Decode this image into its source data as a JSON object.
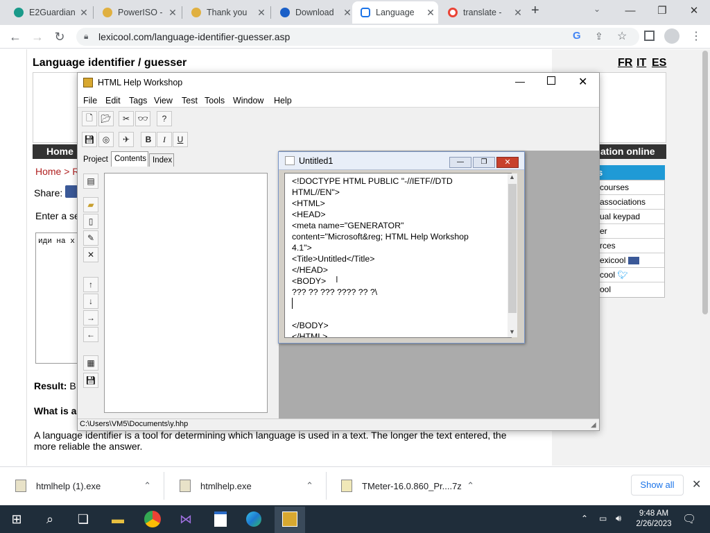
{
  "browser": {
    "tabs": [
      {
        "title": "E2Guardian",
        "color": "#1a9a8a"
      },
      {
        "title": "PowerISO -",
        "color": "#e0b040"
      },
      {
        "title": "Thank you",
        "color": "#e0b040"
      },
      {
        "title": "Download",
        "color": "#1a5fc8"
      },
      {
        "title": "Language",
        "color": "#1a73e8"
      },
      {
        "title": "translate -",
        "color": "#ea4335"
      }
    ],
    "url": "lexicool.com/language-identifier-guesser.asp"
  },
  "page": {
    "heading": "Language identifier / guesser",
    "lang_links": [
      "FR",
      "IT",
      "ES"
    ],
    "nav_home": "Home",
    "nav_right": "ation online",
    "breadcrumb_home": "Home",
    "breadcrumb_sep": " > R",
    "share_label": "Share:",
    "enter_text": "Enter a se",
    "textarea_value": "иди на х",
    "result_label": "Result:",
    "result_value": " B",
    "what_is": "What is a",
    "description": "A language identifier is a tool for determining which language is used in a text. The longer the text entered, the more reliable the answer.",
    "sidebar_header": "s",
    "sidebar_items": [
      "courses",
      "associations",
      "ual keypad",
      "er",
      "rces",
      "exicool",
      "cool",
      "ool"
    ]
  },
  "workshop": {
    "title": "HTML Help Workshop",
    "menu": [
      "File",
      "Edit",
      "Tags",
      "View",
      "Test",
      "Tools",
      "Window",
      "Help"
    ],
    "tabs": [
      "Project",
      "Contents",
      "Index"
    ],
    "status": "C:\\Users\\VM5\\Documents\\y.hhp",
    "child_title": "Untitled1",
    "editor_lines": [
      "<!DOCTYPE HTML PUBLIC \"-//IETF//DTD",
      "HTML//EN\">",
      "<HTML>",
      "<HEAD>",
      "<meta name=\"GENERATOR\"",
      "content=\"Microsoft&reg; HTML Help Workshop",
      "4.1\">",
      "<Title>Untitled</Title>",
      "</HEAD>",
      "<BODY>",
      "??? ?? ??? ???? ?? ?\\",
      "",
      "",
      "</BODY>",
      "</HTML>"
    ]
  },
  "downloads": {
    "items": [
      "htmlhelp (1).exe",
      "htmlhelp.exe",
      "TMeter-16.0.860_Pr....7z"
    ],
    "show_all": "Show all"
  },
  "taskbar": {
    "time": "9:48 AM",
    "date": "2/26/2023"
  }
}
